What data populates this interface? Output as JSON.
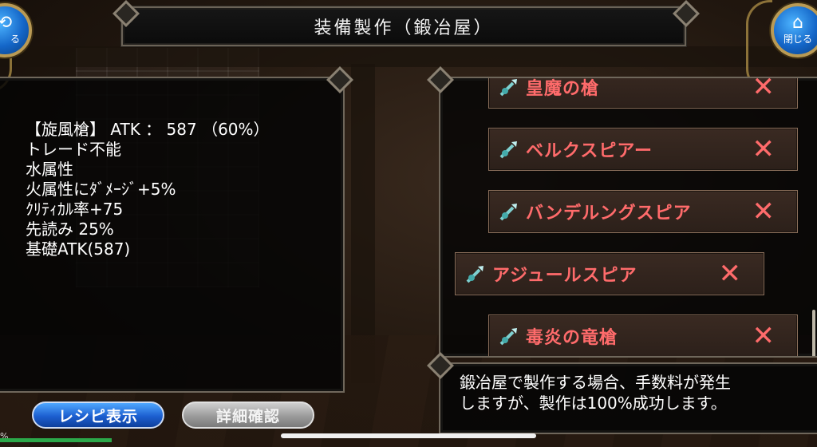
{
  "header": {
    "title": "装備製作（鍛冶屋）"
  },
  "left_round_button": {
    "icon": "back-icon",
    "label": "る"
  },
  "right_round_button": {
    "icon": "home-icon",
    "label": "閉じる"
  },
  "item_info": {
    "lines": [
      "【旋風槍】 ATK ： 587 （60%）",
      "トレード不能",
      "水属性",
      "火属性にﾀﾞﾒｰｼﾞ+5%",
      "ｸﾘﾃｨｶﾙ率+75",
      "先読み 25%",
      "基礎ATK(587)"
    ]
  },
  "recipe_list": {
    "items": [
      {
        "name": "皇魔の槍",
        "mark": "✕",
        "selected": false
      },
      {
        "name": "ベルクスピアー",
        "mark": "✕",
        "selected": false
      },
      {
        "name": "バンデルングスピア",
        "mark": "✕",
        "selected": false
      },
      {
        "name": "アジュールスピア",
        "mark": "✕",
        "selected": true
      },
      {
        "name": "毒炎の竜槍",
        "mark": "✕",
        "selected": false
      }
    ]
  },
  "message": {
    "line1": "鍛冶屋で製作する場合、手数料が発生",
    "line2": "しますが、製作は100%成功します。"
  },
  "buttons": {
    "recipe_label": "レシピ表示",
    "detail_label": "詳細確認"
  },
  "status": {
    "hp_percent_label": "%"
  },
  "colors": {
    "accent_red": "#ff6b6b",
    "button_blue": "#1c5fd0",
    "frame": "#6f675b"
  }
}
